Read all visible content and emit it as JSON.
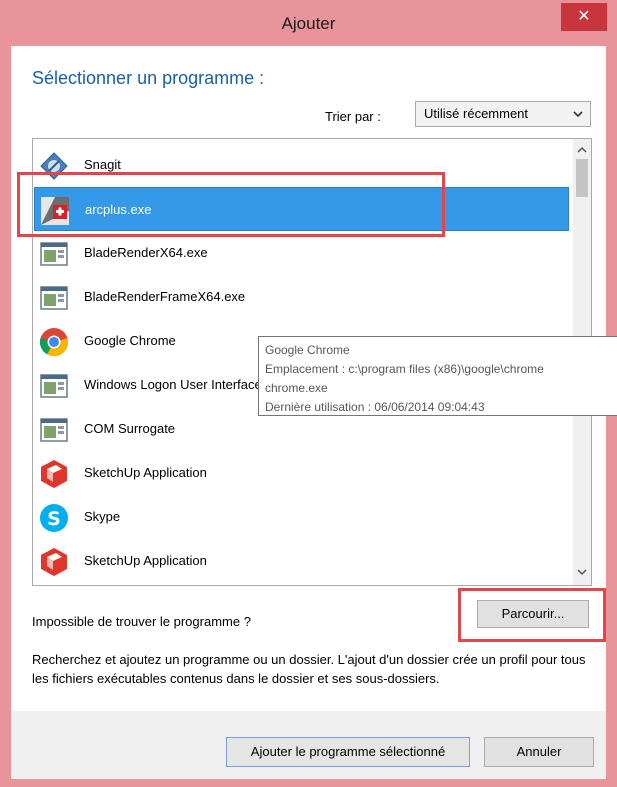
{
  "window": {
    "title": "Ajouter",
    "close_glyph": "✕"
  },
  "heading": "Sélectionner un programme :",
  "sort": {
    "label": "Trier par :",
    "selected": "Utilisé récemment"
  },
  "programs": [
    {
      "name": "Snagit",
      "icon": "snagit-icon"
    },
    {
      "name": "arcplus.exe",
      "icon": "arcplus-icon",
      "selected": true
    },
    {
      "name": "BladeRenderX64.exe",
      "icon": "generic-app-icon"
    },
    {
      "name": "BladeRenderFrameX64.exe",
      "icon": "generic-app-icon"
    },
    {
      "name": "Google Chrome",
      "icon": "chrome-icon"
    },
    {
      "name": "Windows Logon User Interface Host",
      "icon": "generic-app-icon"
    },
    {
      "name": "COM Surrogate",
      "icon": "generic-app-icon"
    },
    {
      "name": "SketchUp Application",
      "icon": "sketchup-icon"
    },
    {
      "name": "Skype",
      "icon": "skype-icon"
    },
    {
      "name": "SketchUp Application",
      "icon": "sketchup-icon"
    }
  ],
  "tooltip": {
    "line1": "Google Chrome",
    "line2": "Emplacement : c:\\program files (x86)\\google\\chrome",
    "line3": "chrome.exe",
    "line4": "Dernière utilisation : 06/06/2014 09:04:43"
  },
  "cant_find": "Impossible de trouver le programme ?",
  "browse_label": "Parcourir...",
  "description": "Recherchez et ajoutez un programme ou un dossier. L'ajout d'un dossier crée un profil pour tous les fichiers exécutables contenus dans le dossier et ses sous-dossiers.",
  "buttons": {
    "add": "Ajouter le programme sélectionné",
    "cancel": "Annuler"
  },
  "colors": {
    "accent": "#1b5faa",
    "selection": "#3399e8",
    "annotation": "#e2454a",
    "frame": "#e8949a",
    "close": "#c8353b"
  }
}
